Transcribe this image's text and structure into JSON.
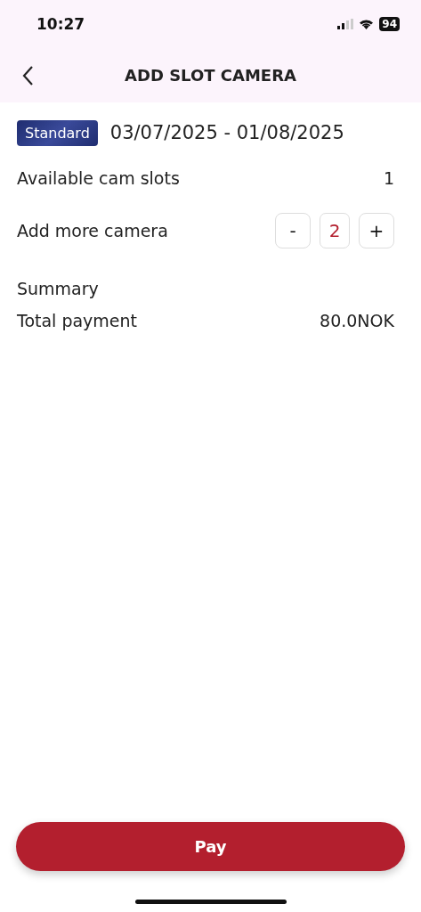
{
  "status_bar": {
    "time": "10:27",
    "battery": "94"
  },
  "header": {
    "title": "ADD SLOT CAMERA"
  },
  "plan": {
    "badge": "Standard",
    "period": "03/07/2025 - 01/08/2025"
  },
  "available": {
    "label": "Available cam slots",
    "value": "1"
  },
  "add_more": {
    "label": "Add more camera",
    "minus": "-",
    "count": "2",
    "plus": "+"
  },
  "summary": {
    "heading": "Summary",
    "label": "Total payment",
    "value": "80.0NOK"
  },
  "pay_button": "Pay"
}
